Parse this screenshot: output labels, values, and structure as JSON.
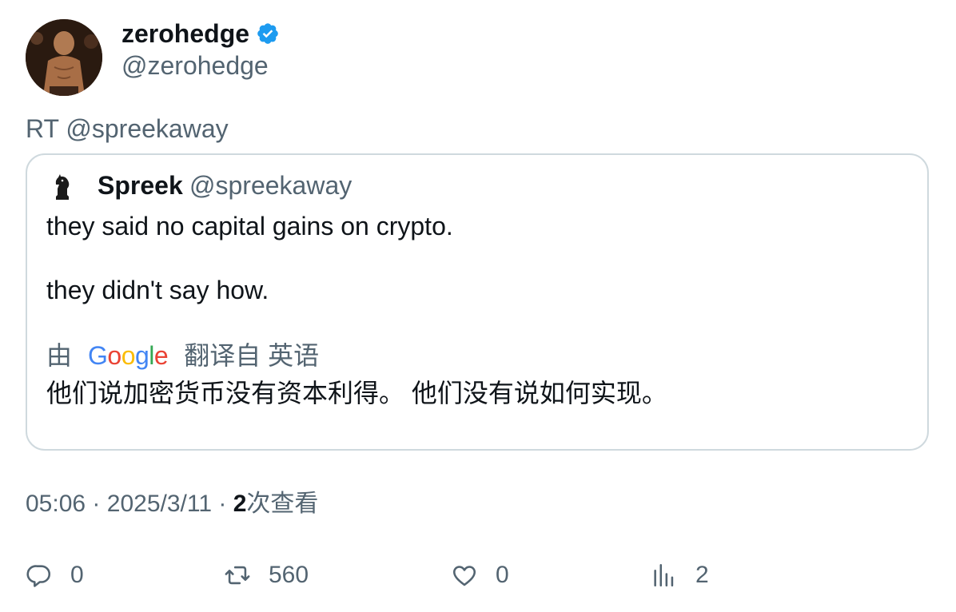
{
  "author": {
    "display_name": "zerohedge",
    "handle": "@zerohedge"
  },
  "retweet": {
    "prefix": "RT @spreekaway"
  },
  "quote": {
    "display_name": "Spreek",
    "handle": "@spreekaway",
    "line1": "they said no capital gains on crypto.",
    "line2": "they didn't say how.",
    "translate_prefix": "由",
    "translate_brand": "Google",
    "translate_suffix": "翻译自 英语",
    "translated_text": "他们说加密货币没有资本利得。 他们没有说如何实现。"
  },
  "meta": {
    "time": "05:06",
    "sep1": "·",
    "date": "2025/3/11",
    "sep2": "·",
    "views_count": "2",
    "views_label": "次查看"
  },
  "actions": {
    "reply_count": "0",
    "retweet_count": "560",
    "like_count": "0",
    "views_count": "2"
  },
  "colors": {
    "text": "#0f1419",
    "muted": "#536471",
    "border": "#cfd9de",
    "verified": "#1d9bf0"
  }
}
